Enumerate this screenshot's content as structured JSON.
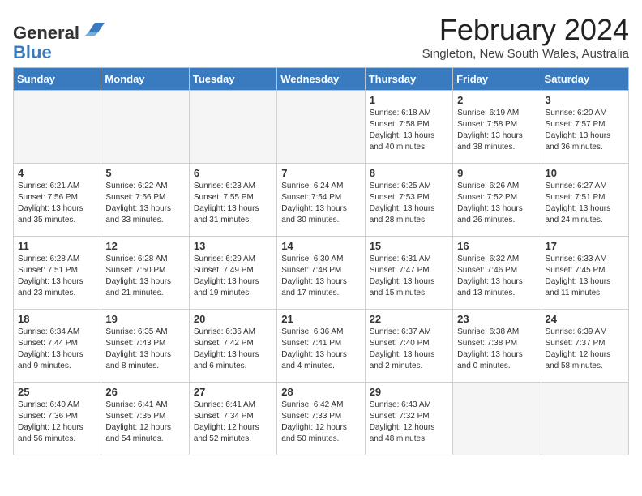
{
  "header": {
    "logo_line1": "General",
    "logo_line2": "Blue",
    "month_title": "February 2024",
    "location": "Singleton, New South Wales, Australia"
  },
  "weekdays": [
    "Sunday",
    "Monday",
    "Tuesday",
    "Wednesday",
    "Thursday",
    "Friday",
    "Saturday"
  ],
  "weeks": [
    [
      {
        "day": "",
        "info": ""
      },
      {
        "day": "",
        "info": ""
      },
      {
        "day": "",
        "info": ""
      },
      {
        "day": "",
        "info": ""
      },
      {
        "day": "1",
        "info": "Sunrise: 6:18 AM\nSunset: 7:58 PM\nDaylight: 13 hours\nand 40 minutes."
      },
      {
        "day": "2",
        "info": "Sunrise: 6:19 AM\nSunset: 7:58 PM\nDaylight: 13 hours\nand 38 minutes."
      },
      {
        "day": "3",
        "info": "Sunrise: 6:20 AM\nSunset: 7:57 PM\nDaylight: 13 hours\nand 36 minutes."
      }
    ],
    [
      {
        "day": "4",
        "info": "Sunrise: 6:21 AM\nSunset: 7:56 PM\nDaylight: 13 hours\nand 35 minutes."
      },
      {
        "day": "5",
        "info": "Sunrise: 6:22 AM\nSunset: 7:56 PM\nDaylight: 13 hours\nand 33 minutes."
      },
      {
        "day": "6",
        "info": "Sunrise: 6:23 AM\nSunset: 7:55 PM\nDaylight: 13 hours\nand 31 minutes."
      },
      {
        "day": "7",
        "info": "Sunrise: 6:24 AM\nSunset: 7:54 PM\nDaylight: 13 hours\nand 30 minutes."
      },
      {
        "day": "8",
        "info": "Sunrise: 6:25 AM\nSunset: 7:53 PM\nDaylight: 13 hours\nand 28 minutes."
      },
      {
        "day": "9",
        "info": "Sunrise: 6:26 AM\nSunset: 7:52 PM\nDaylight: 13 hours\nand 26 minutes."
      },
      {
        "day": "10",
        "info": "Sunrise: 6:27 AM\nSunset: 7:51 PM\nDaylight: 13 hours\nand 24 minutes."
      }
    ],
    [
      {
        "day": "11",
        "info": "Sunrise: 6:28 AM\nSunset: 7:51 PM\nDaylight: 13 hours\nand 23 minutes."
      },
      {
        "day": "12",
        "info": "Sunrise: 6:28 AM\nSunset: 7:50 PM\nDaylight: 13 hours\nand 21 minutes."
      },
      {
        "day": "13",
        "info": "Sunrise: 6:29 AM\nSunset: 7:49 PM\nDaylight: 13 hours\nand 19 minutes."
      },
      {
        "day": "14",
        "info": "Sunrise: 6:30 AM\nSunset: 7:48 PM\nDaylight: 13 hours\nand 17 minutes."
      },
      {
        "day": "15",
        "info": "Sunrise: 6:31 AM\nSunset: 7:47 PM\nDaylight: 13 hours\nand 15 minutes."
      },
      {
        "day": "16",
        "info": "Sunrise: 6:32 AM\nSunset: 7:46 PM\nDaylight: 13 hours\nand 13 minutes."
      },
      {
        "day": "17",
        "info": "Sunrise: 6:33 AM\nSunset: 7:45 PM\nDaylight: 13 hours\nand 11 minutes."
      }
    ],
    [
      {
        "day": "18",
        "info": "Sunrise: 6:34 AM\nSunset: 7:44 PM\nDaylight: 13 hours\nand 9 minutes."
      },
      {
        "day": "19",
        "info": "Sunrise: 6:35 AM\nSunset: 7:43 PM\nDaylight: 13 hours\nand 8 minutes."
      },
      {
        "day": "20",
        "info": "Sunrise: 6:36 AM\nSunset: 7:42 PM\nDaylight: 13 hours\nand 6 minutes."
      },
      {
        "day": "21",
        "info": "Sunrise: 6:36 AM\nSunset: 7:41 PM\nDaylight: 13 hours\nand 4 minutes."
      },
      {
        "day": "22",
        "info": "Sunrise: 6:37 AM\nSunset: 7:40 PM\nDaylight: 13 hours\nand 2 minutes."
      },
      {
        "day": "23",
        "info": "Sunrise: 6:38 AM\nSunset: 7:38 PM\nDaylight: 13 hours\nand 0 minutes."
      },
      {
        "day": "24",
        "info": "Sunrise: 6:39 AM\nSunset: 7:37 PM\nDaylight: 12 hours\nand 58 minutes."
      }
    ],
    [
      {
        "day": "25",
        "info": "Sunrise: 6:40 AM\nSunset: 7:36 PM\nDaylight: 12 hours\nand 56 minutes."
      },
      {
        "day": "26",
        "info": "Sunrise: 6:41 AM\nSunset: 7:35 PM\nDaylight: 12 hours\nand 54 minutes."
      },
      {
        "day": "27",
        "info": "Sunrise: 6:41 AM\nSunset: 7:34 PM\nDaylight: 12 hours\nand 52 minutes."
      },
      {
        "day": "28",
        "info": "Sunrise: 6:42 AM\nSunset: 7:33 PM\nDaylight: 12 hours\nand 50 minutes."
      },
      {
        "day": "29",
        "info": "Sunrise: 6:43 AM\nSunset: 7:32 PM\nDaylight: 12 hours\nand 48 minutes."
      },
      {
        "day": "",
        "info": ""
      },
      {
        "day": "",
        "info": ""
      }
    ]
  ]
}
